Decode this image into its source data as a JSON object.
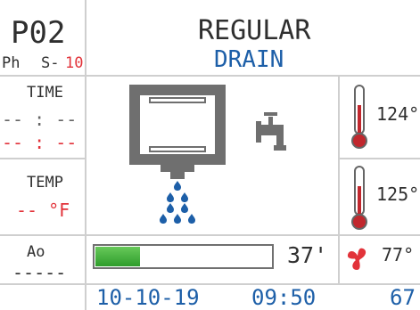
{
  "program": {
    "code": "P02",
    "ph_label": "Ph",
    "step_prefix": "S-",
    "step_value": "10"
  },
  "cycle": {
    "name": "REGULAR",
    "phase": "DRAIN"
  },
  "left_panel": {
    "time_label": "TIME",
    "time_value_primary": "-- : --",
    "time_value_secondary": "-- : --",
    "temp_label": "TEMP",
    "temp_value": "-- °F",
    "ao_label": "Ao",
    "ao_value": "-----"
  },
  "readings": {
    "temp1": "124°",
    "temp2": "125°",
    "fan_temp": "77°"
  },
  "progress": {
    "fraction": 0.25,
    "remaining": "37'"
  },
  "footer": {
    "date": "10-10-19",
    "time": "09:50",
    "value": "67"
  },
  "colors": {
    "accent_blue": "#1d5fa8",
    "alarm_red": "#e2333a",
    "progress_green": "#2f9d2c"
  },
  "icons": {
    "main_graphic": "washer-drain-icon",
    "faucet": "water-faucet-icon",
    "thermometer": "thermometer-icon",
    "fan": "fan-icon"
  }
}
